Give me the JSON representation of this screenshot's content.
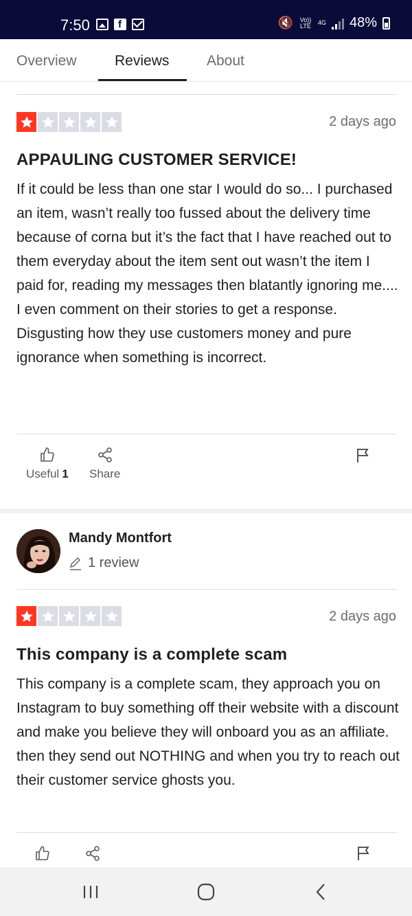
{
  "status_bar": {
    "time": "7:50",
    "signal_label_top": "Vo)) LTE",
    "network": "4G",
    "battery": "48%"
  },
  "tabs": [
    {
      "label": "Overview",
      "active": false
    },
    {
      "label": "Reviews",
      "active": true
    },
    {
      "label": "About",
      "active": false
    }
  ],
  "reviews": [
    {
      "rating": 1,
      "max_rating": 5,
      "date": "2 days ago",
      "title": "APPAULING CUSTOMER SERVICE!",
      "body": "If it could be less than one star I would do so... I purchased an item, wasn’t really too fussed about the delivery time because of corna but it’s the fact that I have reached out to them everyday about the item sent out wasn’t the item I paid for, reading my messages then blatantly ignoring me.... I even comment on their stories to get a response.\nDisgusting how they use customers money and pure ignorance when something is incorrect.",
      "useful_label": "Useful",
      "useful_count": "1",
      "share_label": "Share"
    },
    {
      "reviewer_name": "Mandy Montfort",
      "reviewer_reviews": "1 review",
      "rating": 1,
      "max_rating": 5,
      "date": "2 days ago",
      "title": "This company is a complete scam",
      "body": "This company is a complete scam, they approach you on Instagram to buy something off their website with a discount and make you believe they will onboard you as an affiliate. then they send out NOTHING and when you try to reach out their customer service ghosts you."
    }
  ],
  "colors": {
    "star_filled": "#ff3722",
    "star_empty": "#dcdce6",
    "status_bar_bg": "#0b0b3a"
  },
  "icons": [
    "thumbs-up-icon",
    "share-icon",
    "flag-icon",
    "pencil-icon"
  ]
}
